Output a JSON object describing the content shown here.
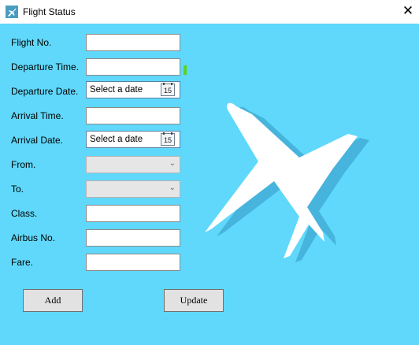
{
  "window": {
    "title": "Flight Status",
    "close_glyph": "✕",
    "app_icon": "airplane-icon"
  },
  "labels": {
    "flight_no": "Flight No.",
    "departure_time": "Departure Time.",
    "departure_date": "Departure Date.",
    "arrival_time": "Arrival Time.",
    "arrival_date": "Arrival Date.",
    "from": "From.",
    "to": "To.",
    "class": "Class.",
    "airbus_no": "Airbus No.",
    "fare": "Fare."
  },
  "fields": {
    "flight_no": "",
    "departure_time": "",
    "arrival_time": "",
    "class": "",
    "airbus_no": "",
    "fare": ""
  },
  "date_pickers": {
    "departure_date_text": "Select a date",
    "arrival_date_text": "Select a date",
    "calendar_day": "15"
  },
  "selects": {
    "from": "",
    "to": ""
  },
  "buttons": {
    "add": "Add",
    "update": "Update"
  },
  "colors": {
    "background": "#5fd8fb",
    "plane": "#ffffff",
    "plane_shadow": "#46b4dc",
    "indicator": "#5bd324"
  }
}
